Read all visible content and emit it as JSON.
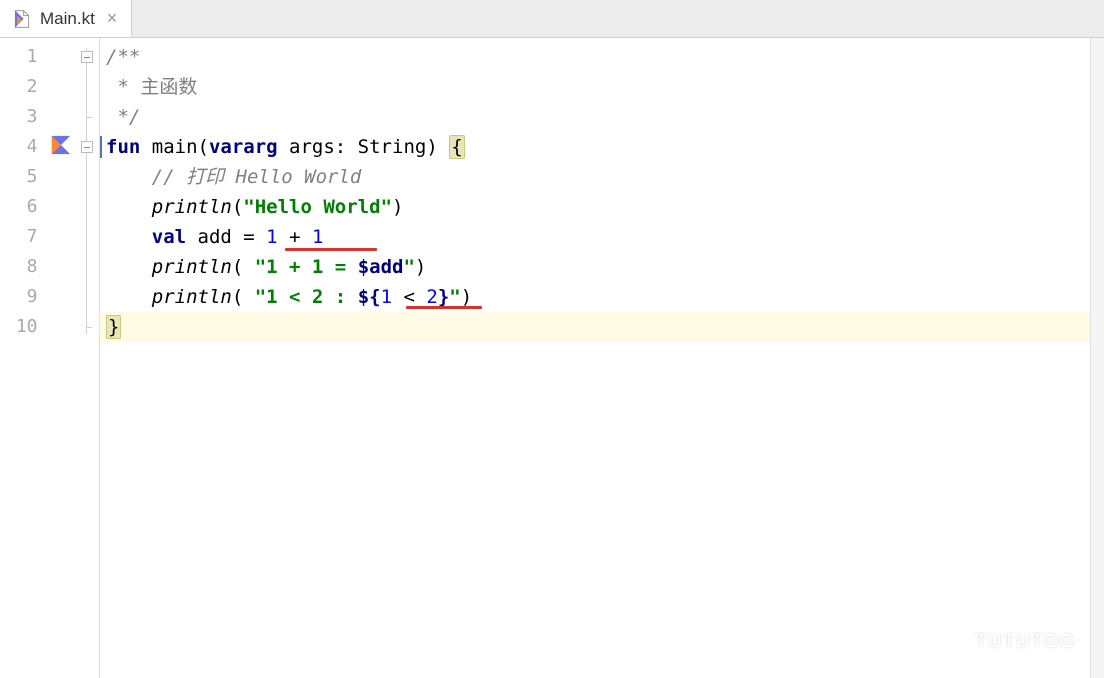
{
  "tab": {
    "filename": "Main.kt"
  },
  "lines": {
    "1": "1",
    "2": "2",
    "3": "3",
    "4": "4",
    "5": "5",
    "6": "6",
    "7": "7",
    "8": "8",
    "9": "9",
    "10": "10"
  },
  "code": {
    "l1": "/**",
    "l2_prefix": " * ",
    "l2_text": "主函数",
    "l3": " */",
    "l4_fun": "fun",
    "l4_main": " main(",
    "l4_vararg": "vararg",
    "l4_args": " args: String) ",
    "l4_brace": "{",
    "l5_indent": "    ",
    "l5_comment": "// 打印 Hello World",
    "l6_indent": "    ",
    "l6_fn": "println",
    "l6_paren_open": "(",
    "l6_str": "\"Hello World\"",
    "l6_paren_close": ")",
    "l7_indent": "    ",
    "l7_val": "val",
    "l7_add": " add = ",
    "l7_n1": "1",
    "l7_plus": " + ",
    "l7_n2": "1",
    "l8_indent": "    ",
    "l8_fn": "println",
    "l8_po": "( ",
    "l8_s1": "\"1 + 1 = ",
    "l8_tmpl": "$add",
    "l8_s2": "\"",
    "l8_pc": ")",
    "l9_indent": "    ",
    "l9_fn": "println",
    "l9_po": "( ",
    "l9_s1": "\"1 < 2 : ",
    "l9_t1": "${",
    "l9_expr_a": "1",
    "l9_expr_op": " < ",
    "l9_expr_b": "2",
    "l9_t2": "}",
    "l9_s2": "\"",
    "l9_pc": ")",
    "l10_brace": "}"
  },
  "watermark": "TUTUTOO"
}
